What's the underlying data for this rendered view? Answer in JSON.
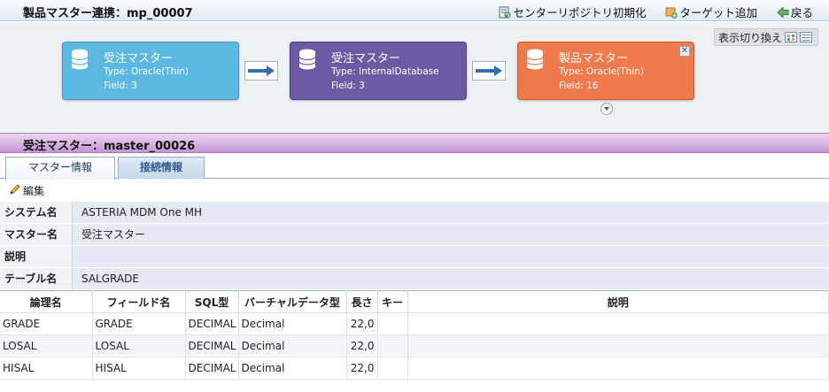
{
  "window": {
    "title": "製品マスター連携：mp_00007",
    "actions": [
      {
        "label": "センターリポジトリ初期化"
      },
      {
        "label": "ターゲット追加"
      },
      {
        "label": "戻る"
      }
    ]
  },
  "diagram": {
    "toggle_label": "表示切り換え",
    "nodes": [
      {
        "name": "受注マスター",
        "type": "Type: Oracle(Thin)",
        "field": "Field: 3",
        "color": "#5bb8e0"
      },
      {
        "name": "受注マスター",
        "type": "Type: InternalDatabase",
        "field": "Field: 3",
        "color": "#6d5aa4"
      },
      {
        "name": "製品マスター",
        "type": "Type: Oracle(Thin)",
        "field": "Field: 16",
        "color": "#ef7a4b"
      }
    ]
  },
  "section": {
    "title": "受注マスター：master_00026"
  },
  "tabs": [
    {
      "label": "マスター情報"
    },
    {
      "label": "接続情報"
    }
  ],
  "edit_label": "編集",
  "info": [
    {
      "label": "システム名",
      "value": "ASTERIA MDM One MH"
    },
    {
      "label": "マスター名",
      "value": "受注マスター"
    },
    {
      "label": "説明",
      "value": ""
    },
    {
      "label": "テーブル名",
      "value": "SALGRADE"
    }
  ],
  "fields": {
    "headers": [
      "論理名",
      "フィールド名",
      "SQL型",
      "バーチャルデータ型",
      "長さ",
      "キー",
      "説明"
    ],
    "rows": [
      [
        "GRADE",
        "GRADE",
        "DECIMAL",
        "Decimal",
        "22,0",
        "",
        ""
      ],
      [
        "LOSAL",
        "LOSAL",
        "DECIMAL",
        "Decimal",
        "22,0",
        "",
        ""
      ],
      [
        "HISAL",
        "HISAL",
        "DECIMAL",
        "Decimal",
        "22,0",
        "",
        ""
      ]
    ]
  }
}
